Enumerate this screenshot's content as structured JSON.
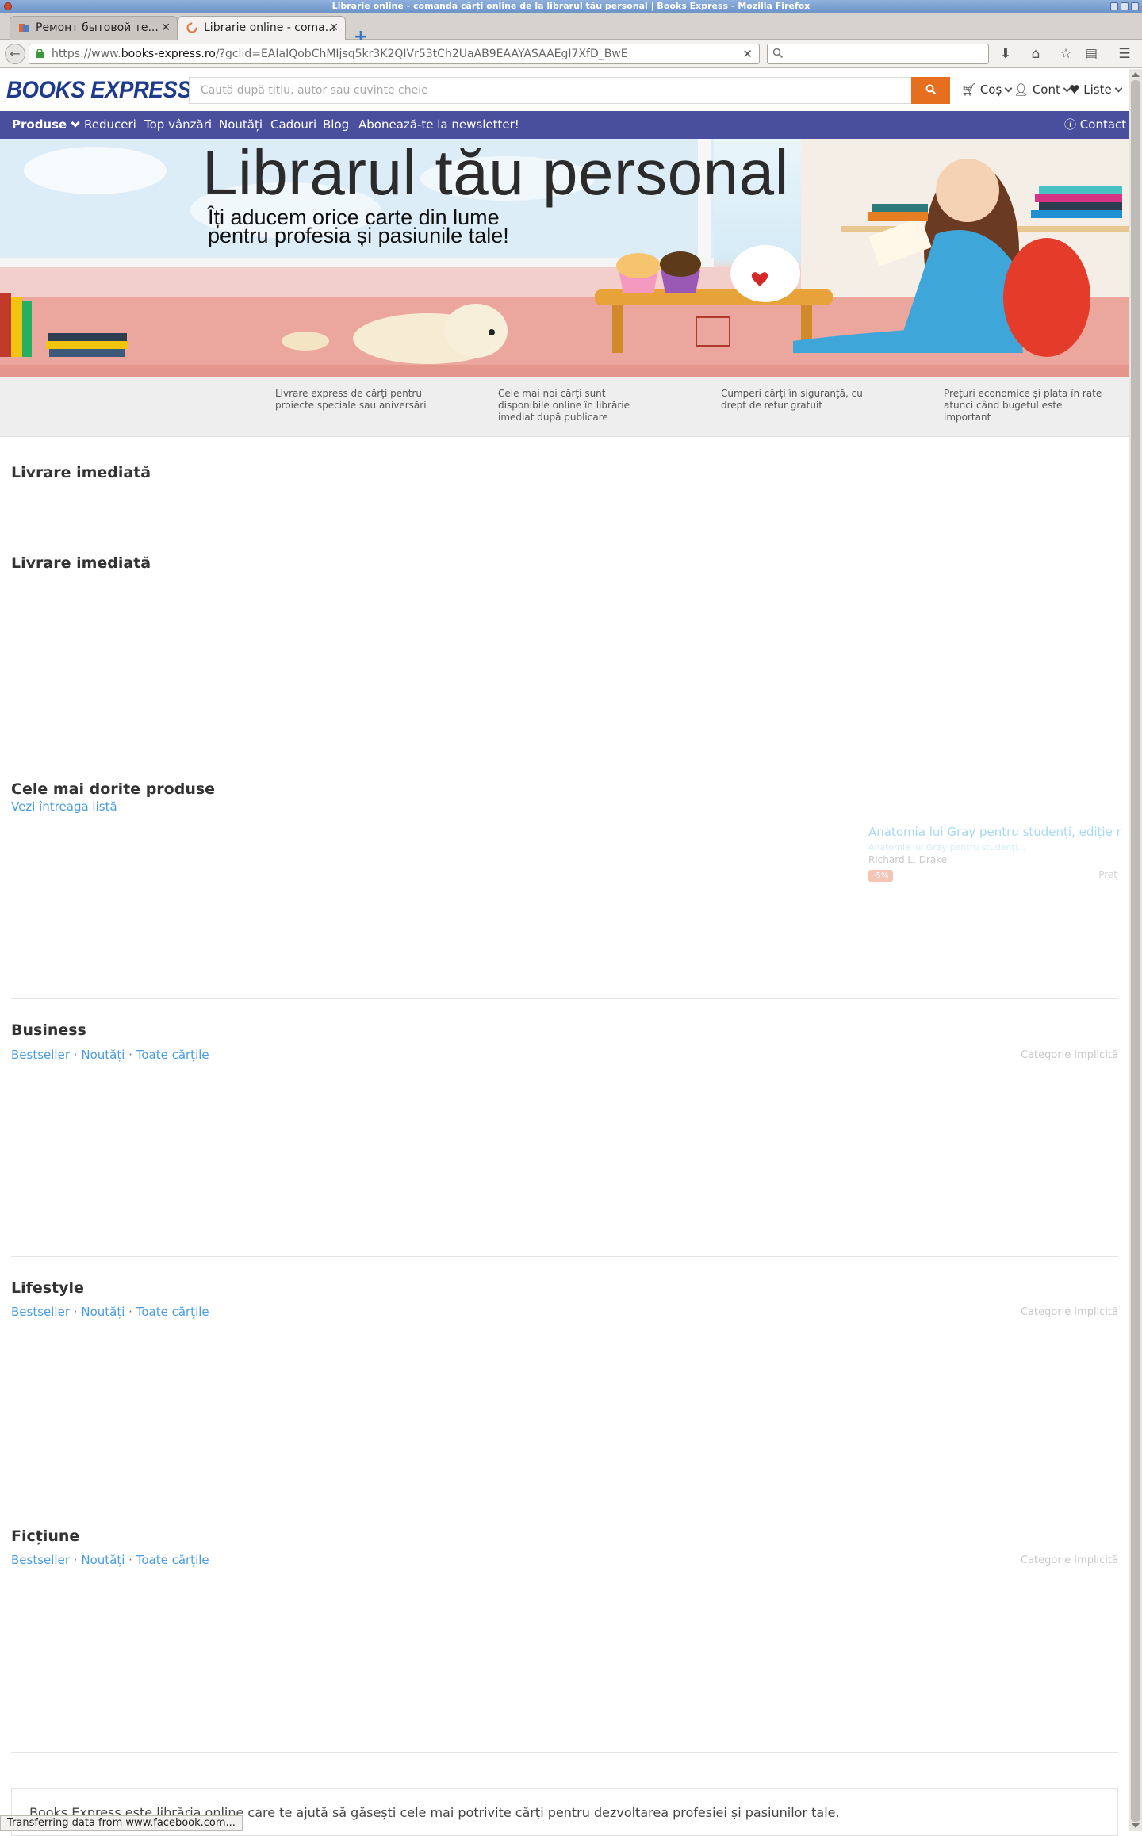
{
  "browser": {
    "window_title": "Librarie online - comanda cărți online de la librarul tău personal | Books Express - Mozilla Firefox",
    "tabs": [
      {
        "label": "Ремонт бытовой те..."
      },
      {
        "label": "Librarie online - coma..."
      }
    ],
    "url_prefix": "https://www.",
    "url_host": "books-express.ro",
    "url_rest": "/?gclid=EAIaIQobChMIjsq5kr3K2QIVr53tCh2UaAB9EAAYASAAEgI7XfD_BwE",
    "status_text": "Transferring data from www.facebook.com..."
  },
  "header": {
    "logo": "BOOKS EXPRESS",
    "search_placeholder": "Caută după titlu, autor sau cuvinte cheie",
    "cart": "Coș",
    "account": "Cont",
    "lists": "Liste"
  },
  "nav": {
    "items": [
      "Produse",
      "Reduceri",
      "Top vânzări",
      "Noutăți",
      "Cadouri",
      "Blog",
      "Abonează-te la newsletter!"
    ],
    "contact": "Contact"
  },
  "hero": {
    "title": "Librarul tău personal",
    "subtitle": "Îți aducem orice carte din lume\npentru profesia și pasiunile tale!"
  },
  "features": [
    "Livrare express de cărți pentru proiecte speciale sau aniversări",
    "Cele mai noi cărți sunt disponibile online în librărie imediat după publicare",
    "Cumperi cărți în siguranță, cu drept de retur gratuit",
    "Prețuri economice și plata în rate atunci când bugetul este important"
  ],
  "sections": {
    "livrare1": "Livrare imediată",
    "livrare2": "Livrare imediată",
    "dorite": {
      "title": "Cele mai dorite produse",
      "link": "Vezi întreaga listă",
      "ghost_title": "Anatomia lui Gray pentru studenți, ediție re",
      "ghost_sub": "Anatomia lui Gray pentru studenți...",
      "ghost_author": "Richard L. Drake",
      "ghost_badge": "-5%",
      "ghost_price": "Preț"
    },
    "link_bestseller": "Bestseller",
    "link_noutati": "Noutăți",
    "link_toate": "Toate cărțile",
    "separator": "·",
    "category_note": "Categorie implicită",
    "business": "Business",
    "lifestyle": "Lifestyle",
    "fictiune": "Ficțiune"
  },
  "footer": {
    "text": "Books Express este librăria online care te ajută să găsești cele mai potrivite cărți pentru dezvoltarea profesiei și pasiunilor tale."
  },
  "colors": {
    "brand_blue": "#1d3a8c",
    "nav_purple": "#4a4f9d",
    "search_orange": "#e66f1f",
    "link_blue": "#4a9de0"
  }
}
